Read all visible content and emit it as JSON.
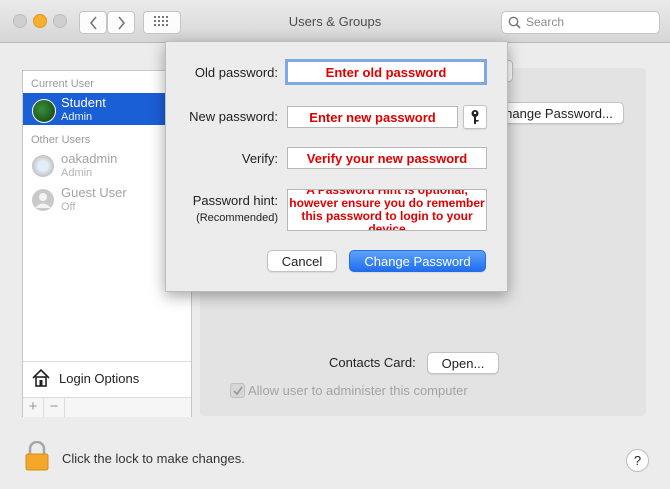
{
  "window": {
    "title": "Users & Groups"
  },
  "toolbar": {
    "back_icon": "chevron-left-icon",
    "forward_icon": "chevron-right-icon",
    "grid_icon": "grid-icon",
    "search_placeholder": "Search"
  },
  "sidebar": {
    "current_user_header": "Current User",
    "current_user": {
      "name": "Student",
      "role": "Admin"
    },
    "other_users_header": "Other Users",
    "other_users": [
      {
        "name": "oakadmin",
        "role": "Admin"
      },
      {
        "name": "Guest User",
        "role": "Off"
      }
    ],
    "login_options_label": "Login Options",
    "add_label": "+",
    "remove_label": "−"
  },
  "main": {
    "change_password_btn": "hange Password...",
    "contacts_card_label": "Contacts Card:",
    "open_btn": "Open...",
    "allow_admin_label": "Allow user to administer this computer",
    "allow_admin_checked": true
  },
  "dialog": {
    "old_password_label": "Old password:",
    "old_password_value": "Enter old password",
    "new_password_label": "New password:",
    "new_password_value": "Enter new password",
    "verify_label": "Verify:",
    "verify_value": "Verify your new password",
    "hint_label": "Password hint:",
    "hint_sublabel": "(Recommended)",
    "hint_value": "A Password Hint is optional, however ensure you do remember this password to login to your device",
    "cancel_label": "Cancel",
    "change_label": "Change Password"
  },
  "footer": {
    "lock_text": "Click the lock to make changes.",
    "help_label": "?"
  },
  "colors": {
    "accent": "#1b5fd6",
    "annotation_red": "#e00000"
  }
}
